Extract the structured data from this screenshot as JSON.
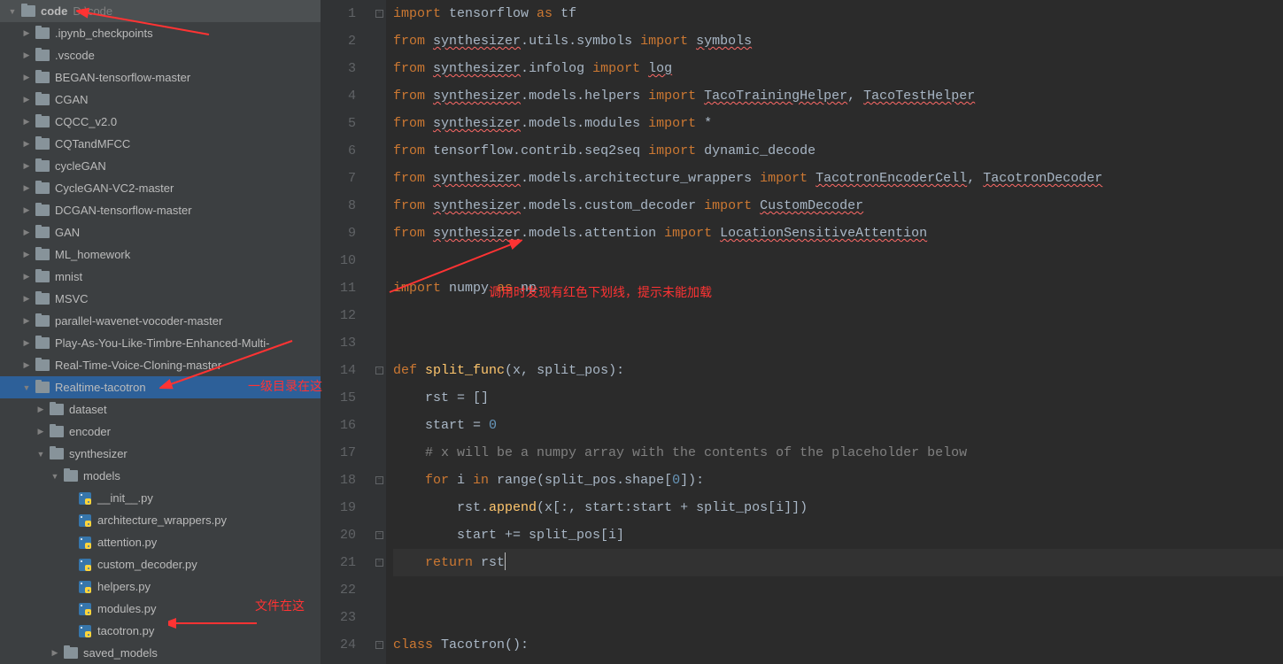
{
  "sidebar": {
    "root": {
      "label": "code",
      "path": "D:\\code"
    },
    "items": [
      {
        "label": ".ipynb_checkpoints",
        "type": "folder",
        "indent": 1,
        "expanded": false
      },
      {
        "label": ".vscode",
        "type": "folder",
        "indent": 1,
        "expanded": false
      },
      {
        "label": "BEGAN-tensorflow-master",
        "type": "folder",
        "indent": 1,
        "expanded": false
      },
      {
        "label": "CGAN",
        "type": "folder",
        "indent": 1,
        "expanded": false
      },
      {
        "label": "CQCC_v2.0",
        "type": "folder",
        "indent": 1,
        "expanded": false
      },
      {
        "label": "CQTandMFCC",
        "type": "folder",
        "indent": 1,
        "expanded": false
      },
      {
        "label": "cycleGAN",
        "type": "folder",
        "indent": 1,
        "expanded": false
      },
      {
        "label": "CycleGAN-VC2-master",
        "type": "folder",
        "indent": 1,
        "expanded": false
      },
      {
        "label": "DCGAN-tensorflow-master",
        "type": "folder",
        "indent": 1,
        "expanded": false
      },
      {
        "label": "GAN",
        "type": "folder",
        "indent": 1,
        "expanded": false
      },
      {
        "label": "ML_homework",
        "type": "folder",
        "indent": 1,
        "expanded": false
      },
      {
        "label": "mnist",
        "type": "folder",
        "indent": 1,
        "expanded": false
      },
      {
        "label": "MSVC",
        "type": "folder",
        "indent": 1,
        "expanded": false
      },
      {
        "label": "parallel-wavenet-vocoder-master",
        "type": "folder",
        "indent": 1,
        "expanded": false
      },
      {
        "label": "Play-As-You-Like-Timbre-Enhanced-Multi-",
        "type": "folder",
        "indent": 1,
        "expanded": false
      },
      {
        "label": "Real-Time-Voice-Cloning-master",
        "type": "folder",
        "indent": 1,
        "expanded": false
      },
      {
        "label": "Realtime-tacotron",
        "type": "folder",
        "indent": 1,
        "expanded": true,
        "selected": true
      },
      {
        "label": "dataset",
        "type": "folder",
        "indent": 2,
        "expanded": false
      },
      {
        "label": "encoder",
        "type": "folder",
        "indent": 2,
        "expanded": false
      },
      {
        "label": "synthesizer",
        "type": "folder",
        "indent": 2,
        "expanded": true
      },
      {
        "label": "models",
        "type": "folder",
        "indent": 3,
        "expanded": true
      },
      {
        "label": "__init__.py",
        "type": "py",
        "indent": 4
      },
      {
        "label": "architecture_wrappers.py",
        "type": "py",
        "indent": 4
      },
      {
        "label": "attention.py",
        "type": "py",
        "indent": 4
      },
      {
        "label": "custom_decoder.py",
        "type": "py",
        "indent": 4
      },
      {
        "label": "helpers.py",
        "type": "py",
        "indent": 4
      },
      {
        "label": "modules.py",
        "type": "py",
        "indent": 4
      },
      {
        "label": "tacotron.py",
        "type": "py",
        "indent": 4
      },
      {
        "label": "saved_models",
        "type": "folder",
        "indent": 3,
        "expanded": false
      }
    ]
  },
  "annotations": {
    "a1": "一级目录在这",
    "a2": "文件在这",
    "a3": "调用时发现有红色下划线，提示未能加载"
  },
  "code": {
    "line_count": 24,
    "lines": [
      {
        "tokens": [
          [
            "kw",
            "import"
          ],
          [
            "id",
            " tensorflow "
          ],
          [
            "kw",
            "as"
          ],
          [
            "id",
            " tf"
          ]
        ]
      },
      {
        "tokens": [
          [
            "kw",
            "from "
          ],
          [
            "idur",
            "synthesizer"
          ],
          [
            "op",
            "."
          ],
          [
            "id",
            "utils"
          ],
          [
            "op",
            "."
          ],
          [
            "id",
            "symbols "
          ],
          [
            "kw",
            "import "
          ],
          [
            "idur",
            "symbols"
          ]
        ]
      },
      {
        "tokens": [
          [
            "kw",
            "from "
          ],
          [
            "idur",
            "synthesizer"
          ],
          [
            "op",
            "."
          ],
          [
            "id",
            "infolog "
          ],
          [
            "kw",
            "import "
          ],
          [
            "idur",
            "log"
          ]
        ]
      },
      {
        "tokens": [
          [
            "kw",
            "from "
          ],
          [
            "idur",
            "synthesizer"
          ],
          [
            "op",
            "."
          ],
          [
            "id",
            "models"
          ],
          [
            "op",
            "."
          ],
          [
            "id",
            "helpers "
          ],
          [
            "kw",
            "import "
          ],
          [
            "idur",
            "TacoTrainingHelper"
          ],
          [
            "op",
            ", "
          ],
          [
            "idur",
            "TacoTestHelper"
          ]
        ]
      },
      {
        "tokens": [
          [
            "kw",
            "from "
          ],
          [
            "idur",
            "synthesizer"
          ],
          [
            "op",
            "."
          ],
          [
            "id",
            "models"
          ],
          [
            "op",
            "."
          ],
          [
            "id",
            "modules "
          ],
          [
            "kw",
            "import "
          ],
          [
            "op",
            "*"
          ]
        ]
      },
      {
        "tokens": [
          [
            "kw",
            "from"
          ],
          [
            "id",
            " tensorflow"
          ],
          [
            "op",
            "."
          ],
          [
            "id",
            "contrib"
          ],
          [
            "op",
            "."
          ],
          [
            "id",
            "seq2seq "
          ],
          [
            "kw",
            "import"
          ],
          [
            "id",
            " dynamic_decode"
          ]
        ]
      },
      {
        "tokens": [
          [
            "kw",
            "from "
          ],
          [
            "idur",
            "synthesizer"
          ],
          [
            "op",
            "."
          ],
          [
            "id",
            "models"
          ],
          [
            "op",
            "."
          ],
          [
            "id",
            "architecture_wrappers "
          ],
          [
            "kw",
            "import "
          ],
          [
            "idur",
            "TacotronEncoderCell"
          ],
          [
            "op",
            ", "
          ],
          [
            "idur",
            "TacotronDecoder"
          ]
        ]
      },
      {
        "tokens": [
          [
            "kw",
            "from "
          ],
          [
            "idur",
            "synthesizer"
          ],
          [
            "op",
            "."
          ],
          [
            "id",
            "models"
          ],
          [
            "op",
            "."
          ],
          [
            "id",
            "custom_decoder "
          ],
          [
            "kw",
            "import "
          ],
          [
            "idur",
            "CustomDecoder"
          ]
        ]
      },
      {
        "tokens": [
          [
            "kw",
            "from "
          ],
          [
            "idur",
            "synthesizer"
          ],
          [
            "op",
            "."
          ],
          [
            "id",
            "models"
          ],
          [
            "op",
            "."
          ],
          [
            "id",
            "attention "
          ],
          [
            "kw",
            "import "
          ],
          [
            "idur",
            "LocationSensitiveAttention"
          ]
        ]
      },
      {
        "tokens": []
      },
      {
        "tokens": [
          [
            "kw",
            "import"
          ],
          [
            "id",
            " numpy "
          ],
          [
            "kw",
            "as"
          ],
          [
            "id",
            " np"
          ]
        ]
      },
      {
        "tokens": []
      },
      {
        "tokens": []
      },
      {
        "tokens": [
          [
            "kw",
            "def "
          ],
          [
            "fn",
            "split_func"
          ],
          [
            "op",
            "(x"
          ],
          [
            "op",
            ", "
          ],
          [
            "op",
            "split_pos):"
          ]
        ]
      },
      {
        "tokens": [
          [
            "id",
            "    rst = []"
          ]
        ]
      },
      {
        "tokens": [
          [
            "id",
            "    start = "
          ],
          [
            "num",
            "0"
          ]
        ]
      },
      {
        "tokens": [
          [
            "comment",
            "    # x will be a numpy array with the contents of the placeholder below"
          ]
        ]
      },
      {
        "tokens": [
          [
            "kw",
            "    for "
          ],
          [
            "id",
            "i "
          ],
          [
            "kw",
            "in "
          ],
          [
            "id",
            "range(split_pos.shape["
          ],
          [
            "num",
            "0"
          ],
          [
            "id",
            "]):"
          ]
        ]
      },
      {
        "tokens": [
          [
            "id",
            "        rst."
          ],
          [
            "fn",
            "append"
          ],
          [
            "id",
            "(x[:"
          ],
          [
            "op",
            ", "
          ],
          [
            "id",
            "start:start + split_pos[i]])"
          ]
        ]
      },
      {
        "tokens": [
          [
            "id",
            "        start += split_pos[i]"
          ]
        ]
      },
      {
        "tokens": [
          [
            "kw",
            "    return "
          ],
          [
            "id",
            "rst"
          ]
        ],
        "current": true
      },
      {
        "tokens": []
      },
      {
        "tokens": []
      },
      {
        "tokens": [
          [
            "kw",
            "class "
          ],
          [
            "cls",
            "Tacotron"
          ],
          [
            "op",
            "():"
          ]
        ]
      }
    ]
  }
}
